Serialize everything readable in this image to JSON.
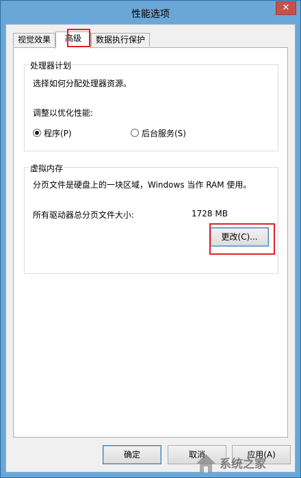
{
  "window": {
    "title": "性能选项",
    "close_glyph": "✕"
  },
  "tabs": [
    {
      "label": "视觉效果"
    },
    {
      "label": "高级"
    },
    {
      "label": "数据执行保护"
    }
  ],
  "processor": {
    "legend": "处理器计划",
    "description": "选择如何分配处理器资源。",
    "adjust_label": "调整以优化性能:",
    "options": [
      {
        "label": "程序(P)",
        "checked": true
      },
      {
        "label": "后台服务(S)",
        "checked": false
      }
    ]
  },
  "virtual_memory": {
    "legend": "虚拟内存",
    "description": "分页文件是硬盘上的一块区域，Windows 当作 RAM 使用。",
    "total_label": "所有驱动器总分页文件大小:",
    "total_value": "1728 MB",
    "change_button": "更改(C)..."
  },
  "buttons": {
    "ok": "确定",
    "cancel": "取消",
    "apply": "应用(A)"
  },
  "watermark": {
    "text": "系统之家"
  },
  "colors": {
    "highlight": "#e02020",
    "titlebar": "#6aa7d6"
  }
}
